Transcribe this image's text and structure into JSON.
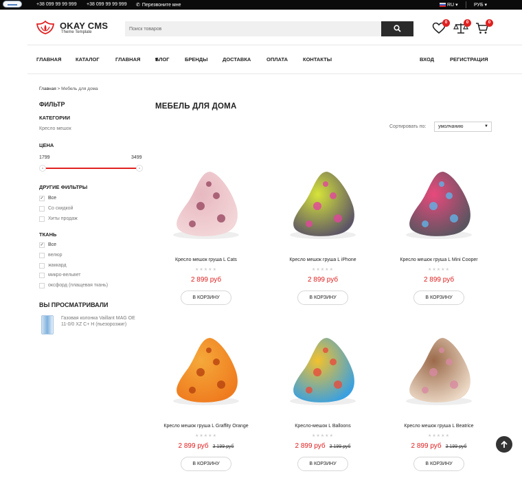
{
  "topbar": {
    "phone1": "+38 099 99 99 999",
    "phone2": "+38 099 99 99 999",
    "callback": "Перезвоните мне",
    "lang": "RU",
    "currency": "РУБ"
  },
  "brand": {
    "name": "OKAY CMS",
    "tagline": "Theme Template"
  },
  "search": {
    "placeholder": "Поиск товаров"
  },
  "header_badges": {
    "wishlist": "0",
    "compare": "0",
    "cart": "0"
  },
  "nav": {
    "items": [
      "ГЛАВНАЯ",
      "КАТАЛОГ",
      "ГЛАВНАЯ",
      "БЛОГ",
      "БРЕНДЫ",
      "ДОСТАВКА",
      "ОПЛАТА",
      "КОНТАКТЫ"
    ],
    "login": "ВХОД",
    "register": "РЕГИСТРАЦИЯ"
  },
  "breadcrumb": {
    "home": "Главная",
    "sep": " > ",
    "current": "Мебель для дома"
  },
  "filter": {
    "title": "ФИЛЬТР",
    "categories_title": "КАТЕГОРИИ",
    "category": "Кресло мешок",
    "price_title": "ЦЕНА",
    "price_min": "1799",
    "price_max": "3499",
    "other_title": "ДРУГИЕ ФИЛЬТРЫ",
    "other": [
      {
        "label": "Все",
        "checked": true
      },
      {
        "label": "Со скидкой",
        "checked": false
      },
      {
        "label": "Хиты продаж",
        "checked": false
      }
    ],
    "fabric_title": "ТКАНЬ",
    "fabric": [
      {
        "label": "Все",
        "checked": true
      },
      {
        "label": "велюр",
        "checked": false
      },
      {
        "label": "жаккард",
        "checked": false
      },
      {
        "label": "микро-вельвет",
        "checked": false
      },
      {
        "label": "оксфорд (плащевая ткань)",
        "checked": false
      }
    ]
  },
  "viewed": {
    "title": "ВЫ ПРОСМАТРИВАЛИ",
    "item": "Газовая колонка Vaillant MAG OE 11-0/0 XZ C+ H (пьезорозжиг)"
  },
  "main": {
    "title": "МЕБЕЛЬ ДЛЯ ДОМА",
    "sort_label": "Сортировать по:",
    "sort_value": "умолчанию",
    "buy_label": "В КОРЗИНУ",
    "stars": "★★★★★"
  },
  "products": [
    {
      "title": "Кресло мешок груша L Cats",
      "price": "2 899 руб",
      "old_price": "",
      "palette": [
        "#f3d6d8",
        "#e7b8c0",
        "#9a4a63"
      ]
    },
    {
      "title": "Кресло мешок груша L iPhone",
      "price": "2 899 руб",
      "old_price": "",
      "palette": [
        "#5c5566",
        "#d6e33a",
        "#e2459c"
      ]
    },
    {
      "title": "Кресло мешок груша L Mini Cooper",
      "price": "2 899 руб",
      "old_price": "",
      "palette": [
        "#5a5560",
        "#e84a7c",
        "#5fb3e6"
      ]
    },
    {
      "title": "Кресло мешок груша L Graffity Orange",
      "price": "2 899 руб",
      "old_price": "3 199 руб",
      "palette": [
        "#ef7b1f",
        "#f5a93a",
        "#b6420f"
      ]
    },
    {
      "title": "Кресло-мешок L Balloons",
      "price": "2 899 руб",
      "old_price": "3 199 руб",
      "palette": [
        "#3aa0e0",
        "#f2c12e",
        "#e74c3c"
      ]
    },
    {
      "title": "Кресло мешок груша L Beatrice",
      "price": "2 899 руб",
      "old_price": "3 199 руб",
      "palette": [
        "#ecd9c6",
        "#9b6a4a",
        "#d88aa1"
      ]
    }
  ]
}
